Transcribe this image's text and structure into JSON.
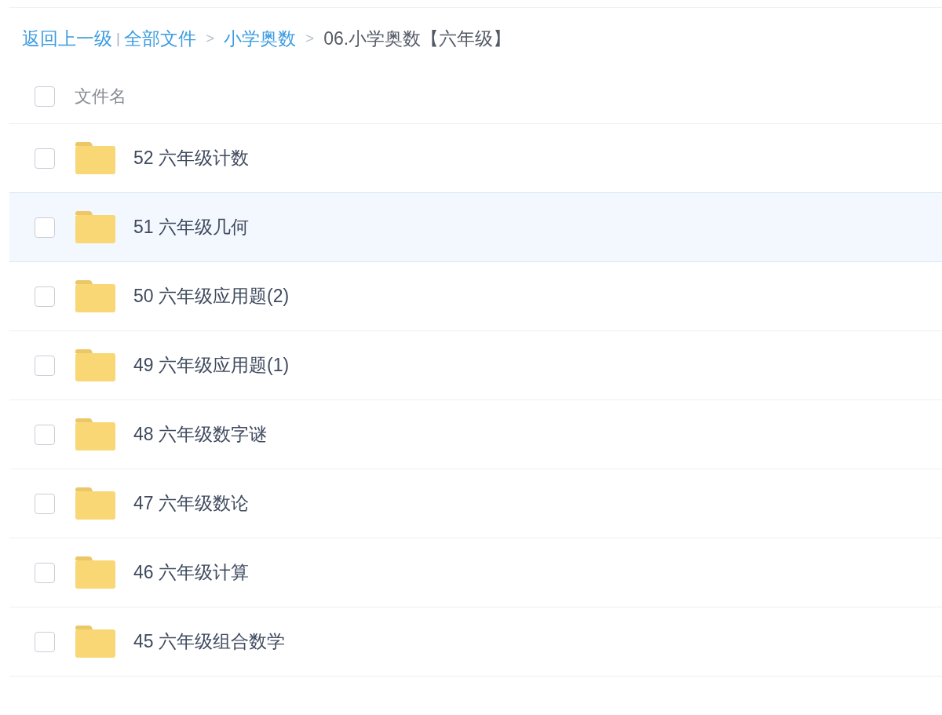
{
  "breadcrumb": [
    {
      "kind": "link",
      "label": "返回上一级"
    },
    {
      "kind": "divider",
      "label": "|"
    },
    {
      "kind": "link",
      "label": "全部文件"
    },
    {
      "kind": "separator",
      "label": ">"
    },
    {
      "kind": "link",
      "label": "小学奥数"
    },
    {
      "kind": "separator",
      "label": ">"
    },
    {
      "kind": "current",
      "label": "06.小学奥数【六年级】"
    }
  ],
  "header": {
    "checked": false,
    "label": "文件名"
  },
  "files": [
    {
      "name": "52 六年级计数",
      "checked": false,
      "highlighted": false
    },
    {
      "name": "51 六年级几何",
      "checked": false,
      "highlighted": true
    },
    {
      "name": "50 六年级应用题(2)",
      "checked": false,
      "highlighted": false
    },
    {
      "name": "49 六年级应用题(1)",
      "checked": false,
      "highlighted": false
    },
    {
      "name": "48 六年级数字谜",
      "checked": false,
      "highlighted": false
    },
    {
      "name": "47 六年级数论",
      "checked": false,
      "highlighted": false
    },
    {
      "name": "46 六年级计算",
      "checked": false,
      "highlighted": false
    },
    {
      "name": "45 六年级组合数学",
      "checked": false,
      "highlighted": false
    }
  ]
}
